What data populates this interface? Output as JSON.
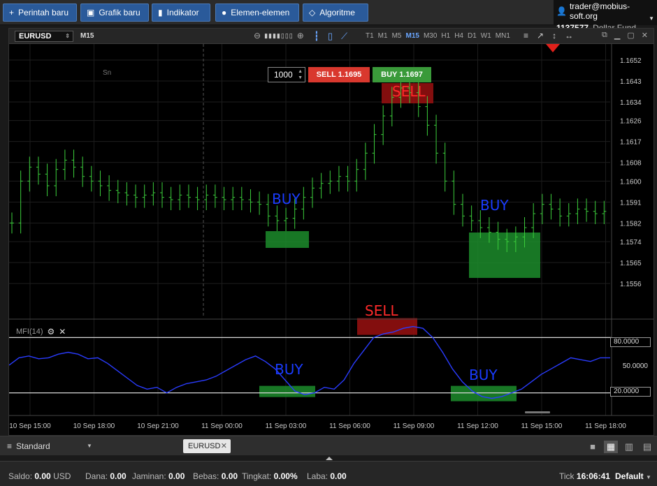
{
  "toolbar": {
    "new_order": "Perintah baru",
    "new_chart": "Grafik baru",
    "indicator": "Indikator",
    "elements": "Elemen-elemen",
    "algorithm": "Algoritme"
  },
  "account": {
    "user": "trader@mobius-soft.org",
    "number": "1137577",
    "fund": "Dollar Fund"
  },
  "chart": {
    "symbol": "EURUSD",
    "timeframe": "M15",
    "timeframes": [
      "T1",
      "M1",
      "M5",
      "M15",
      "M30",
      "H1",
      "H4",
      "D1",
      "W1",
      "MN1"
    ],
    "active_timeframe": "M15",
    "sn_label": "Sn",
    "quantity": "1000",
    "sell_label": "SELL",
    "sell_price": "1.1695",
    "buy_label": "BUY",
    "buy_price": "1.1697",
    "mfi_label": "MFI(14)",
    "level_80": "80.0000",
    "level_50": "50.0000",
    "level_20": "20.0000",
    "annotations": {
      "buy": "BUY",
      "sell": "SELL"
    }
  },
  "chart_data": {
    "type": "candlestick",
    "price_axis_ticks": [
      "1.1652",
      "1.1643",
      "1.1634",
      "1.1626",
      "1.1617",
      "1.1608",
      "1.1600",
      "1.1591",
      "1.1582",
      "1.1574",
      "1.1565",
      "1.1556"
    ],
    "time_axis_ticks": [
      "10 Sep 15:00",
      "10 Sep 18:00",
      "10 Sep 21:00",
      "11 Sep 00:00",
      "11 Sep 03:00",
      "11 Sep 06:00",
      "11 Sep 09:00",
      "11 Sep 12:00",
      "11 Sep 15:00",
      "11 Sep 18:00"
    ],
    "price_series": [
      1.1582,
      1.16,
      1.1606,
      1.1603,
      1.1598,
      1.1605,
      1.1609,
      1.1606,
      1.1602,
      1.16,
      1.1598,
      1.1596,
      1.1595,
      1.1594,
      1.1593,
      1.1594,
      1.1595,
      1.1593,
      1.1592,
      1.1594,
      1.1593,
      1.1592,
      1.1594,
      1.1593,
      1.1592,
      1.1593,
      1.1592,
      1.1591,
      1.159,
      1.1585,
      1.1583,
      1.1584,
      1.1588,
      1.1593,
      1.1597,
      1.1599,
      1.16,
      1.1602,
      1.16,
      1.1605,
      1.1612,
      1.162,
      1.1628,
      1.1636,
      1.164,
      1.1638,
      1.1632,
      1.1624,
      1.1612,
      1.16,
      1.159,
      1.1585,
      1.1583,
      1.158,
      1.1578,
      1.1575,
      1.1574,
      1.1576,
      1.158,
      1.1586,
      1.159,
      1.1588,
      1.1585,
      1.1586,
      1.1588,
      1.1587,
      1.1586,
      1.1587
    ],
    "mfi_series": [
      50,
      58,
      60,
      57,
      58,
      62,
      64,
      62,
      57,
      58,
      52,
      44,
      36,
      28,
      24,
      26,
      20,
      26,
      30,
      32,
      34,
      38,
      44,
      50,
      56,
      60,
      54,
      46,
      34,
      22,
      18,
      20,
      26,
      24,
      34,
      52,
      66,
      80,
      84,
      86,
      90,
      92,
      90,
      80,
      64,
      46,
      32,
      22,
      16,
      14,
      16,
      20,
      24,
      32,
      40,
      46,
      52,
      58,
      56,
      54,
      58,
      58
    ],
    "mfi_levels": [
      80,
      50,
      20
    ],
    "mfi_range": [
      0,
      100
    ],
    "signals": [
      {
        "label": "BUY",
        "region": "11 Sep 03:00"
      },
      {
        "label": "SELL",
        "region": "11 Sep 09:00"
      },
      {
        "label": "BUY",
        "region": "11 Sep 13:00"
      }
    ]
  },
  "tabs": {
    "layout": "Standard",
    "active_tab": "EURUSD"
  },
  "status": {
    "balance_label": "Saldo:",
    "balance_value": "0.00",
    "balance_currency": "USD",
    "funds_label": "Dana:",
    "funds_value": "0.00",
    "margin_label": "Jaminan:",
    "margin_value": "0.00",
    "free_label": "Bebas:",
    "free_value": "0.00",
    "level_label": "Tingkat:",
    "level_value": "0.00%",
    "profit_label": "Laba:",
    "profit_value": "0.00",
    "tick_label": "Tick",
    "time": "16:06:41",
    "profile": "Default"
  },
  "colors": {
    "accent": "#2a5a9a",
    "candle": "#3ccf3c",
    "mfi_line": "#2a3cff",
    "buy_zone": "#1c8c2c",
    "sell_zone": "#9a1010",
    "sell_button": "#d9382e",
    "buy_button": "#3a9a3a"
  }
}
